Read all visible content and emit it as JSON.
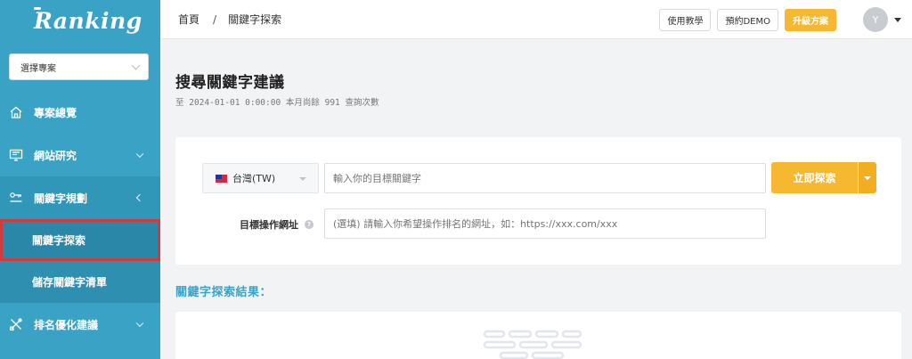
{
  "sidebar": {
    "logo": "Ranking",
    "project_select": "選擇專案",
    "nav": [
      {
        "label": "專案總覽",
        "icon": "home-icon"
      },
      {
        "label": "網站研究",
        "icon": "monitor-icon"
      },
      {
        "label": "關鍵字規劃",
        "icon": "keyword-icon"
      },
      {
        "label": "排名優化建議",
        "icon": "tools-icon"
      }
    ],
    "sub": [
      {
        "label": "關鍵字探索"
      },
      {
        "label": "儲存關鍵字清單"
      }
    ]
  },
  "topbar": {
    "breadcrumb": [
      "首頁",
      "關鍵字探索"
    ],
    "separator": "/",
    "tutorial": "使用教學",
    "demo": "預約DEMO",
    "upgrade": "升級方案",
    "avatar": "Y"
  },
  "main": {
    "title": "搜尋關鍵字建議",
    "quota": "至 2024-01-01 0:00:00 本月尚餘 991 查詢次數",
    "country": "台灣(TW)",
    "keyword_placeholder": "輸入你的目標關鍵字",
    "search_button": "立即探索",
    "url_label": "目標操作網址",
    "url_placeholder": "(選填) 請輸入你希望操作排名的網址，如：https://xxx.com/xxx",
    "results_title": "關鍵字探索結果："
  },
  "colors": {
    "sidebar": "#3aa3c5",
    "accent": "#f6b731",
    "highlight_border": "#d23b3b"
  }
}
